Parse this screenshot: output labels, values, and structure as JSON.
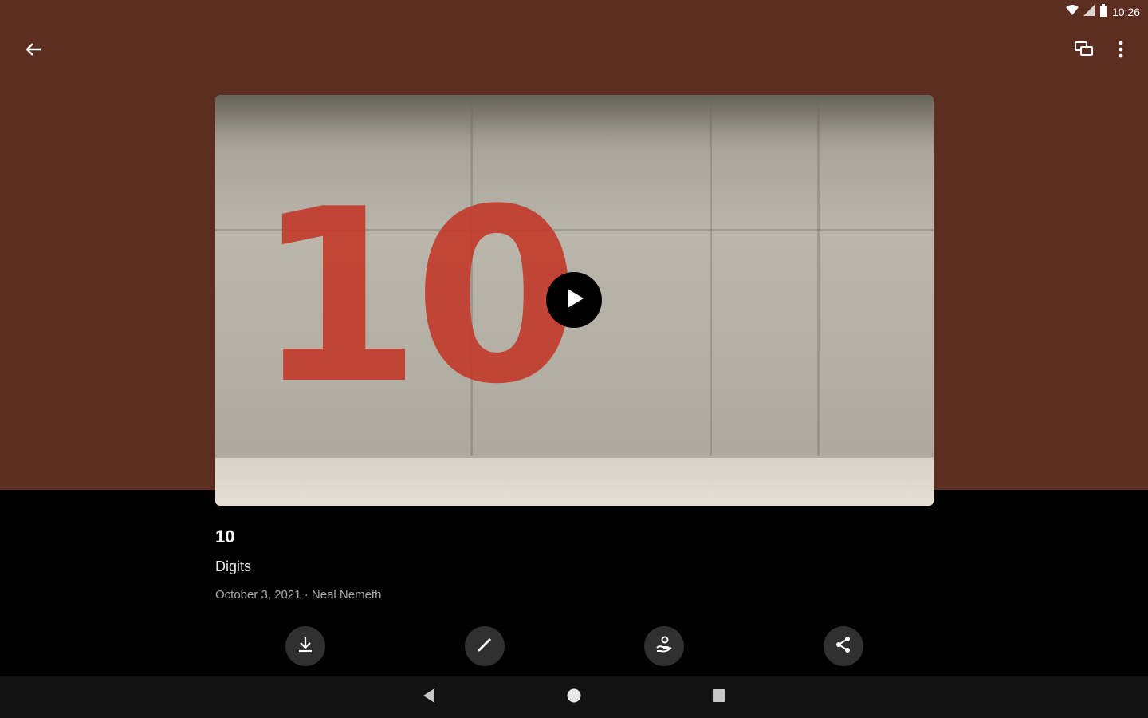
{
  "status": {
    "time": "10:26"
  },
  "header": {
    "back_icon": "arrow-left-icon",
    "chat_icon": "chat-bubbles-icon",
    "more_icon": "more-vertical-icon"
  },
  "video": {
    "thumbnail_text": "10",
    "play_icon": "play-icon"
  },
  "details": {
    "title": "10",
    "subtitle": "Digits",
    "meta": "October 3, 2021 · Neal Nemeth"
  },
  "actions": [
    {
      "icon": "download-icon"
    },
    {
      "icon": "edit-pencil-icon"
    },
    {
      "icon": "hand-person-icon"
    },
    {
      "icon": "share-icon"
    }
  ],
  "navbar": {
    "back_icon": "nav-back-icon",
    "home_icon": "nav-home-icon",
    "recents_icon": "nav-recents-icon"
  },
  "colors": {
    "top_background": "#5c2d21",
    "bottom_background": "#000000",
    "accent": "#c33a2a"
  }
}
